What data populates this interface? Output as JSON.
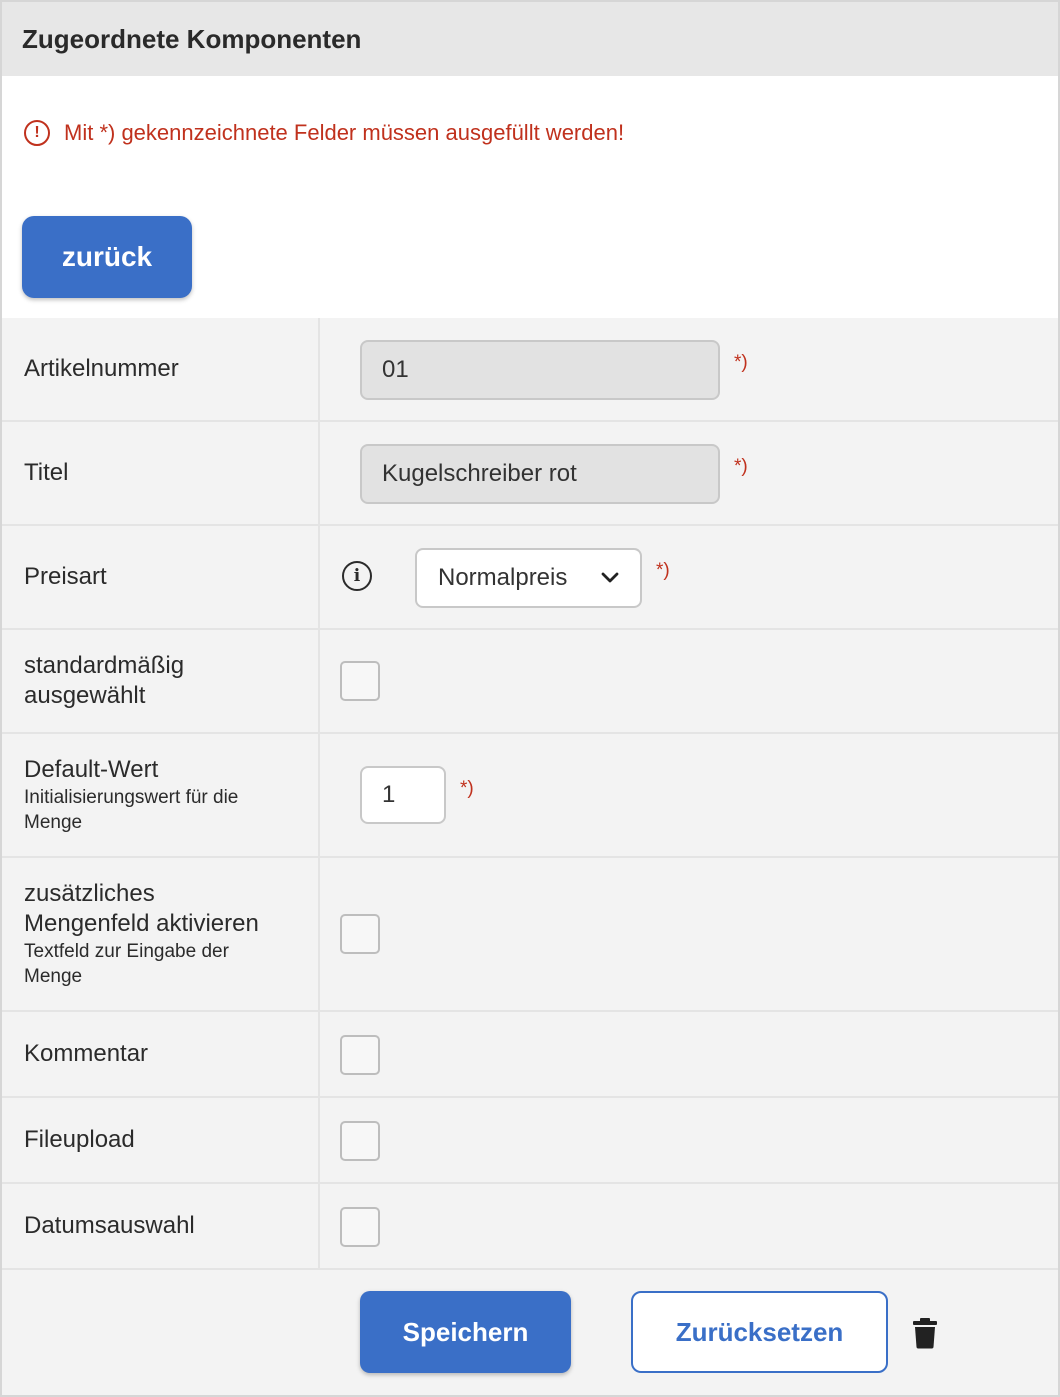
{
  "header": {
    "title": "Zugeordnete Komponenten"
  },
  "notice": {
    "icon": "exclamation-circle-icon",
    "text": "Mit *) gekennzeichnete Felder müssen ausgefüllt werden!",
    "color": "#c0311d"
  },
  "back_button": {
    "label": "zurück"
  },
  "required_marker": "*)",
  "fields": {
    "artikelnummer": {
      "label": "Artikelnummer",
      "value": "01"
    },
    "titel": {
      "label": "Titel",
      "value": "Kugelschreiber rot"
    },
    "preisart": {
      "label": "Preisart",
      "info_icon": "info-circle-icon",
      "selected": "Normalpreis"
    },
    "standard": {
      "label_line1": "standardmäßig",
      "label_line2": "ausgewählt",
      "checked": false
    },
    "default_wert": {
      "label": "Default-Wert",
      "sub_line1": "Initialisierungswert für die",
      "sub_line2": "Menge",
      "value": "1"
    },
    "mengenfeld": {
      "label_line1": "zusätzliches",
      "label_line2": "Mengenfeld aktivieren",
      "sub_line1": "Textfeld zur Eingabe der",
      "sub_line2": "Menge",
      "checked": false
    },
    "kommentar": {
      "label": "Kommentar",
      "checked": false
    },
    "fileupload": {
      "label": "Fileupload",
      "checked": false
    },
    "datumsauswahl": {
      "label": "Datumsauswahl",
      "checked": false
    }
  },
  "footer": {
    "save_label": "Speichern",
    "reset_label": "Zurücksetzen",
    "delete_icon": "trash-icon"
  },
  "colors": {
    "primary": "#3a6fc7",
    "error": "#c0311d",
    "header_bg": "#e7e7e7",
    "form_bg": "#f3f3f3"
  }
}
